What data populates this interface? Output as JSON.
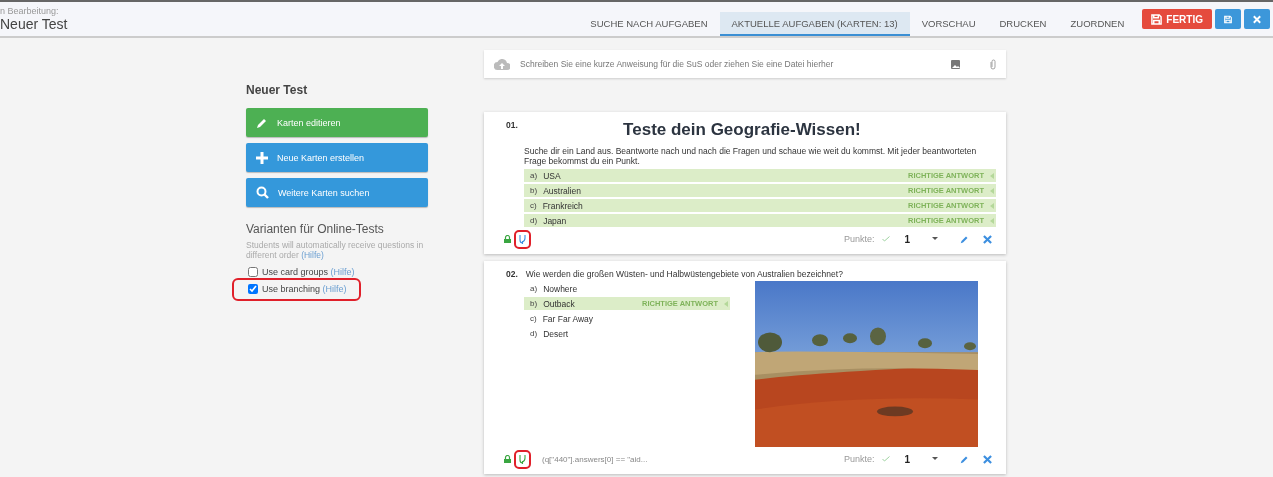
{
  "header": {
    "caption": "n Bearbeitung:",
    "title": "Neuer Test"
  },
  "tabs": [
    {
      "label": "SUCHE NACH AUFGABEN",
      "selected": false
    },
    {
      "label": "AKTUELLE AUFGABEN (KARTEN: 13)",
      "selected": true
    },
    {
      "label": "VORSCHAU",
      "selected": false
    },
    {
      "label": "DRUCKEN",
      "selected": false
    },
    {
      "label": "ZUORDNEN",
      "selected": false
    }
  ],
  "actions": [
    {
      "kind": "finish",
      "label": "FERTIG"
    },
    {
      "kind": "save"
    },
    {
      "kind": "close"
    }
  ],
  "sidebar": {
    "title": "Neuer Test",
    "buttons": [
      {
        "kind": "edit",
        "label": "Karten editieren"
      },
      {
        "kind": "add",
        "label": "Neue Karten erstellen"
      },
      {
        "kind": "search",
        "label": "Weitere Karten suchen"
      }
    ],
    "variants_title": "Varianten für Online-Tests",
    "variants_text": "Students will automatically receive questions in different order",
    "variants_help": "(Hilfe)",
    "options": [
      {
        "label": "Use card groups",
        "help": "(Hilfe)",
        "checked": false,
        "annotated": false
      },
      {
        "label": "Use branching",
        "help": "(Hilfe)",
        "checked": true,
        "annotated": true
      }
    ]
  },
  "instruction": {
    "placeholder": "Schreiben Sie eine kurze Anweisung für die SuS oder ziehen Sie eine Datei hierher"
  },
  "cards": [
    {
      "number": "01.",
      "title": "Teste dein Geografie-Wissen!",
      "text": "Suche dir ein Land aus. Beantworte nach und nach die Fragen und schaue wie weit du kommst. Mit jeder beantworteten Frage bekommst du ein Punkt.",
      "has_picture": false,
      "answers": [
        {
          "letter": "a)",
          "text": "USA",
          "correct": true,
          "tag": "RICHTIGE ANTWORT"
        },
        {
          "letter": "b)",
          "text": "Australien",
          "correct": true,
          "tag": "RICHTIGE ANTWORT"
        },
        {
          "letter": "c)",
          "text": "Frankreich",
          "correct": true,
          "tag": "RICHTIGE ANTWORT"
        },
        {
          "letter": "d)",
          "text": "Japan",
          "correct": true,
          "tag": "RICHTIGE ANTWORT"
        }
      ],
      "branch_condition_set": false,
      "branch_annotated": true,
      "points_label": "Punkte:",
      "points": "1"
    },
    {
      "number": "02.",
      "text": "Wie werden die großen Wüsten- und Halbwüstengebiete von Australien bezeichnet?",
      "has_picture": true,
      "answers": [
        {
          "letter": "a)",
          "text": "Nowhere",
          "correct": false
        },
        {
          "letter": "b)",
          "text": "Outback",
          "correct": true,
          "tag": "RICHTIGE ANTWORT"
        },
        {
          "letter": "c)",
          "text": "Far Far Away",
          "correct": false
        },
        {
          "letter": "d)",
          "text": "Desert",
          "correct": false
        }
      ],
      "branch_condition_set": true,
      "condition": "(q[\"440\"].answers[0] == \"aid...",
      "branch_annotated": true,
      "points_label": "Punkte:",
      "points": "1"
    }
  ]
}
